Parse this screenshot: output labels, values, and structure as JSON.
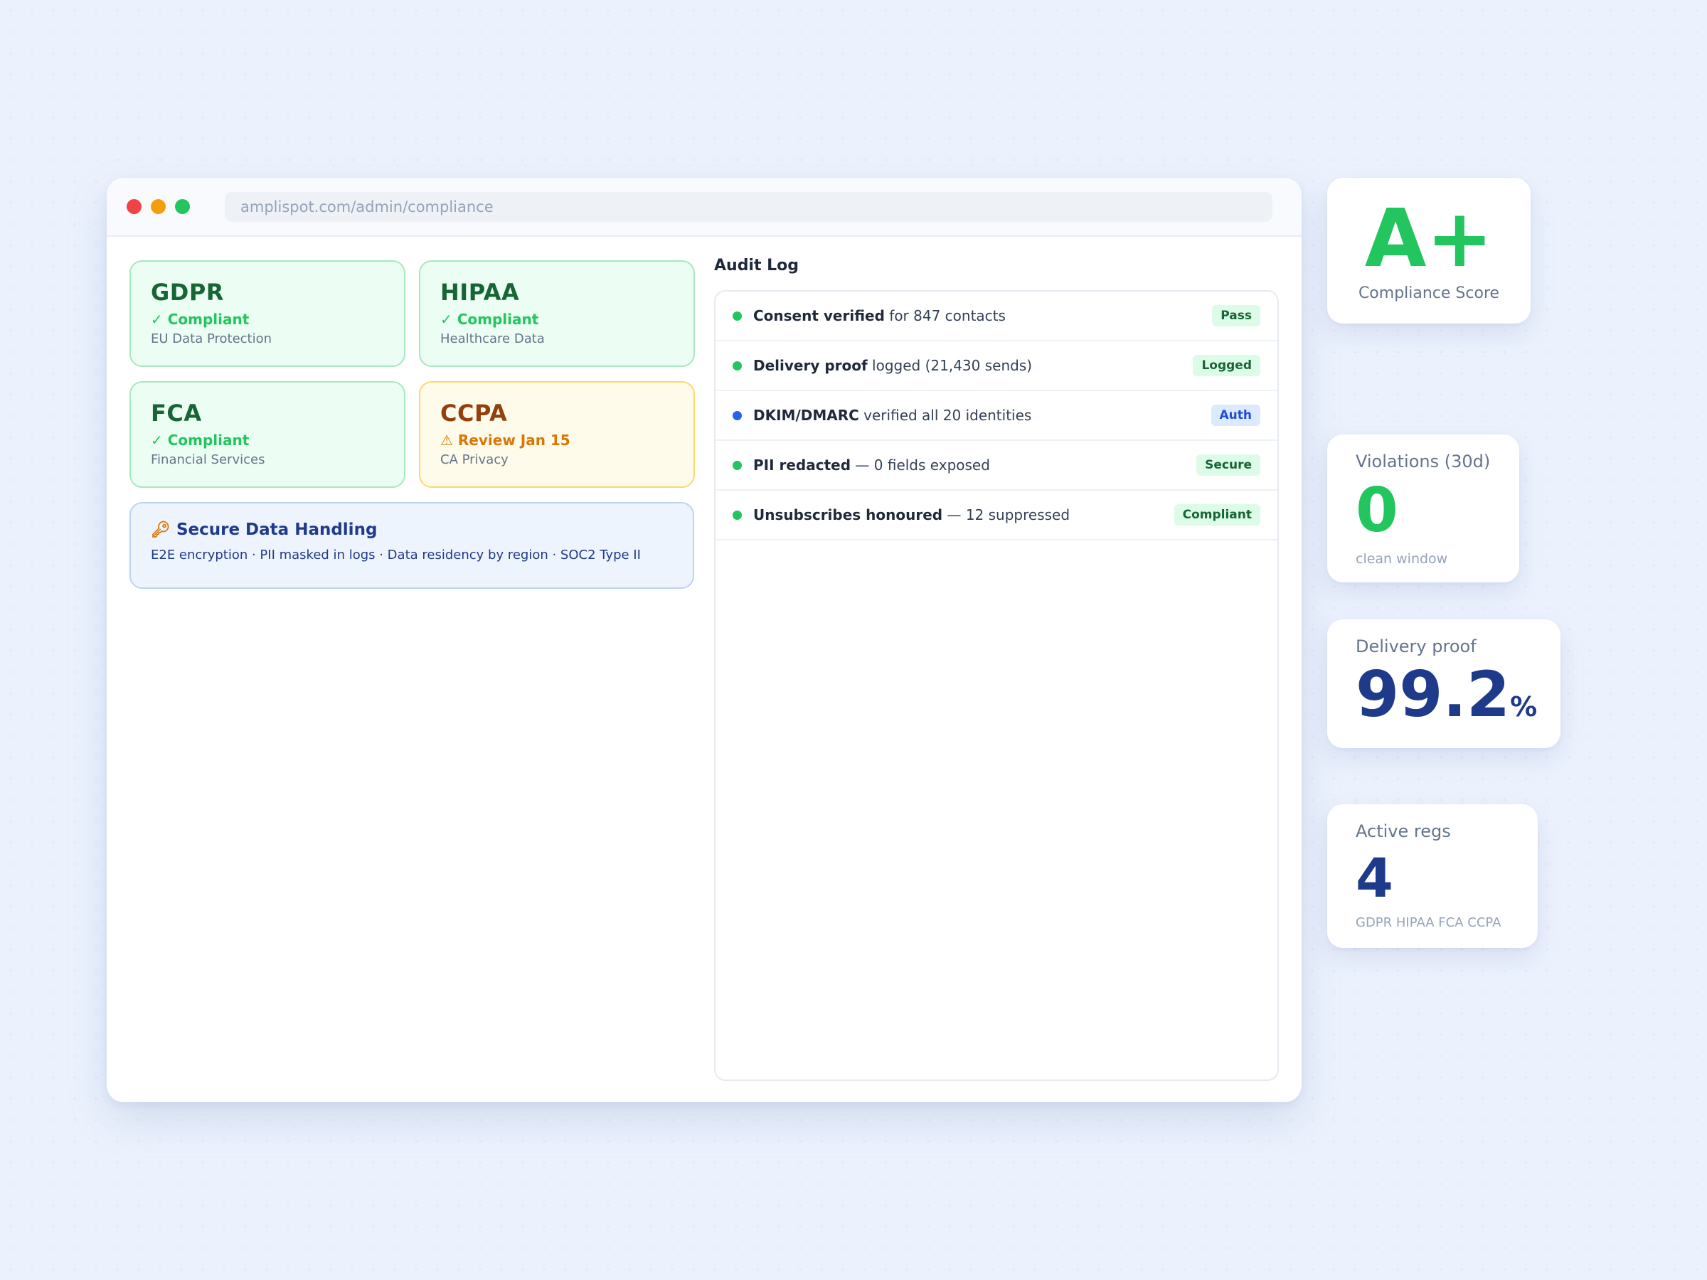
{
  "browser": {
    "url": "amplispot.com/admin/compliance"
  },
  "regulations": [
    {
      "name": "GDPR",
      "status": "✓ Compliant",
      "description": "EU Data Protection"
    },
    {
      "name": "HIPAA",
      "status": "✓ Compliant",
      "description": "Healthcare Data"
    },
    {
      "name": "FCA",
      "status": "✓ Compliant",
      "description": "Financial Services"
    },
    {
      "name": "CCPA",
      "status": "⚠ Review Jan 15",
      "description": "CA Privacy"
    }
  ],
  "secure_data": {
    "icon": "key-icon",
    "title": "Secure Data Handling",
    "text": "E2E encryption · PII masked in logs · Data residency by region · SOC2 Type II"
  },
  "audit_log": {
    "title": "Audit Log",
    "entries": [
      {
        "bold": "Consent verified",
        "rest": " for 847 contacts",
        "badge": "Pass",
        "dot_color": "#22c55e"
      },
      {
        "bold": "Delivery proof",
        "rest": " logged (21,430 sends)",
        "badge": "Logged",
        "dot_color": "#22c55e"
      },
      {
        "bold": "DKIM/DMARC",
        "rest": " verified all 20 identities",
        "badge": "Auth",
        "dot_color": "#2563eb"
      },
      {
        "bold": "PII redacted",
        "rest": " — 0 fields exposed",
        "badge": "Secure",
        "dot_color": "#22c55e"
      },
      {
        "bold": "Unsubscribes honoured",
        "rest": " — 12 suppressed",
        "badge": "Compliant",
        "dot_color": "#22c55e"
      }
    ]
  },
  "stats": {
    "score": {
      "value": "A+",
      "label": "Compliance Score"
    },
    "violations": {
      "label": "Violations (30d)",
      "value": "0",
      "sub": "clean window"
    },
    "delivery": {
      "label": "Delivery proof",
      "value": "99.2",
      "unit": "%"
    },
    "active_regs": {
      "label": "Active regs",
      "value": "4",
      "sub": "GDPR HIPAA FCA CCPA"
    }
  },
  "colors": {
    "compliant": "#22c55e",
    "warning": "#d97706",
    "navy": "#1e3a8a",
    "info": "#2563eb"
  }
}
